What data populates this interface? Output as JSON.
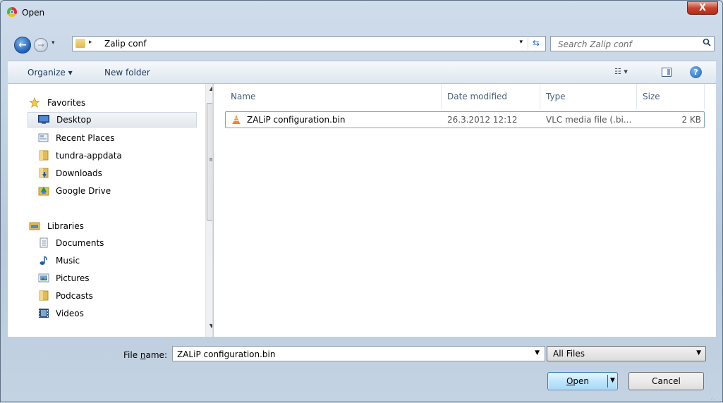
{
  "window": {
    "title": "Open",
    "close_glyph": "X"
  },
  "nav": {
    "back_glyph": "←",
    "forward_glyph": "→",
    "history_glyph": "▾",
    "address": {
      "separator": "▸",
      "path": "Zalip conf",
      "dropdown": "▾",
      "refresh_glyph": "⇆"
    },
    "search_placeholder": "Search Zalip conf"
  },
  "toolbar": {
    "organize_label": "Organize ▾",
    "new_folder_label": "New folder",
    "views_glyph": "☷ ▾",
    "help_glyph": "?"
  },
  "sidebar": {
    "favorites_label": "Favorites",
    "favorites": [
      {
        "label": "Desktop",
        "icon": "desktop-icon"
      },
      {
        "label": "Recent Places",
        "icon": "recent-places-icon"
      },
      {
        "label": "tundra-appdata",
        "icon": "folder-icon"
      },
      {
        "label": "Downloads",
        "icon": "downloads-folder-icon"
      },
      {
        "label": "Google Drive",
        "icon": "google-drive-icon"
      }
    ],
    "libraries_label": "Libraries",
    "libraries": [
      {
        "label": "Documents",
        "icon": "documents-icon"
      },
      {
        "label": "Music",
        "icon": "music-icon"
      },
      {
        "label": "Pictures",
        "icon": "pictures-icon"
      },
      {
        "label": "Podcasts",
        "icon": "podcasts-folder-icon"
      },
      {
        "label": "Videos",
        "icon": "videos-icon"
      }
    ],
    "scroll_up": "▲",
    "scroll_down": "▼",
    "scroll_grip": "≡"
  },
  "columns": {
    "name": "Name",
    "date": "Date modified",
    "type": "Type",
    "size": "Size",
    "sort_glyph": "▴"
  },
  "files": [
    {
      "name": "ZALiP configuration.bin",
      "date": "26.3.2012 12:12",
      "type": "VLC media file (.bi...",
      "size": "2 KB"
    }
  ],
  "footer": {
    "file_name_label_pre": "File ",
    "file_name_label_u": "n",
    "file_name_label_post": "ame:",
    "file_name_value": "ZALiP configuration.bin",
    "file_name_dropdown": "▼",
    "filter_value": "All Files",
    "filter_dropdown": "▼",
    "open_label_u": "O",
    "open_label_rest": "pen",
    "open_dropdown": "▼",
    "cancel_label": "Cancel",
    "resize_grip": "∴"
  },
  "colors": {
    "accent": "#1b5fb8",
    "vlc_orange": "#f08a1c"
  }
}
